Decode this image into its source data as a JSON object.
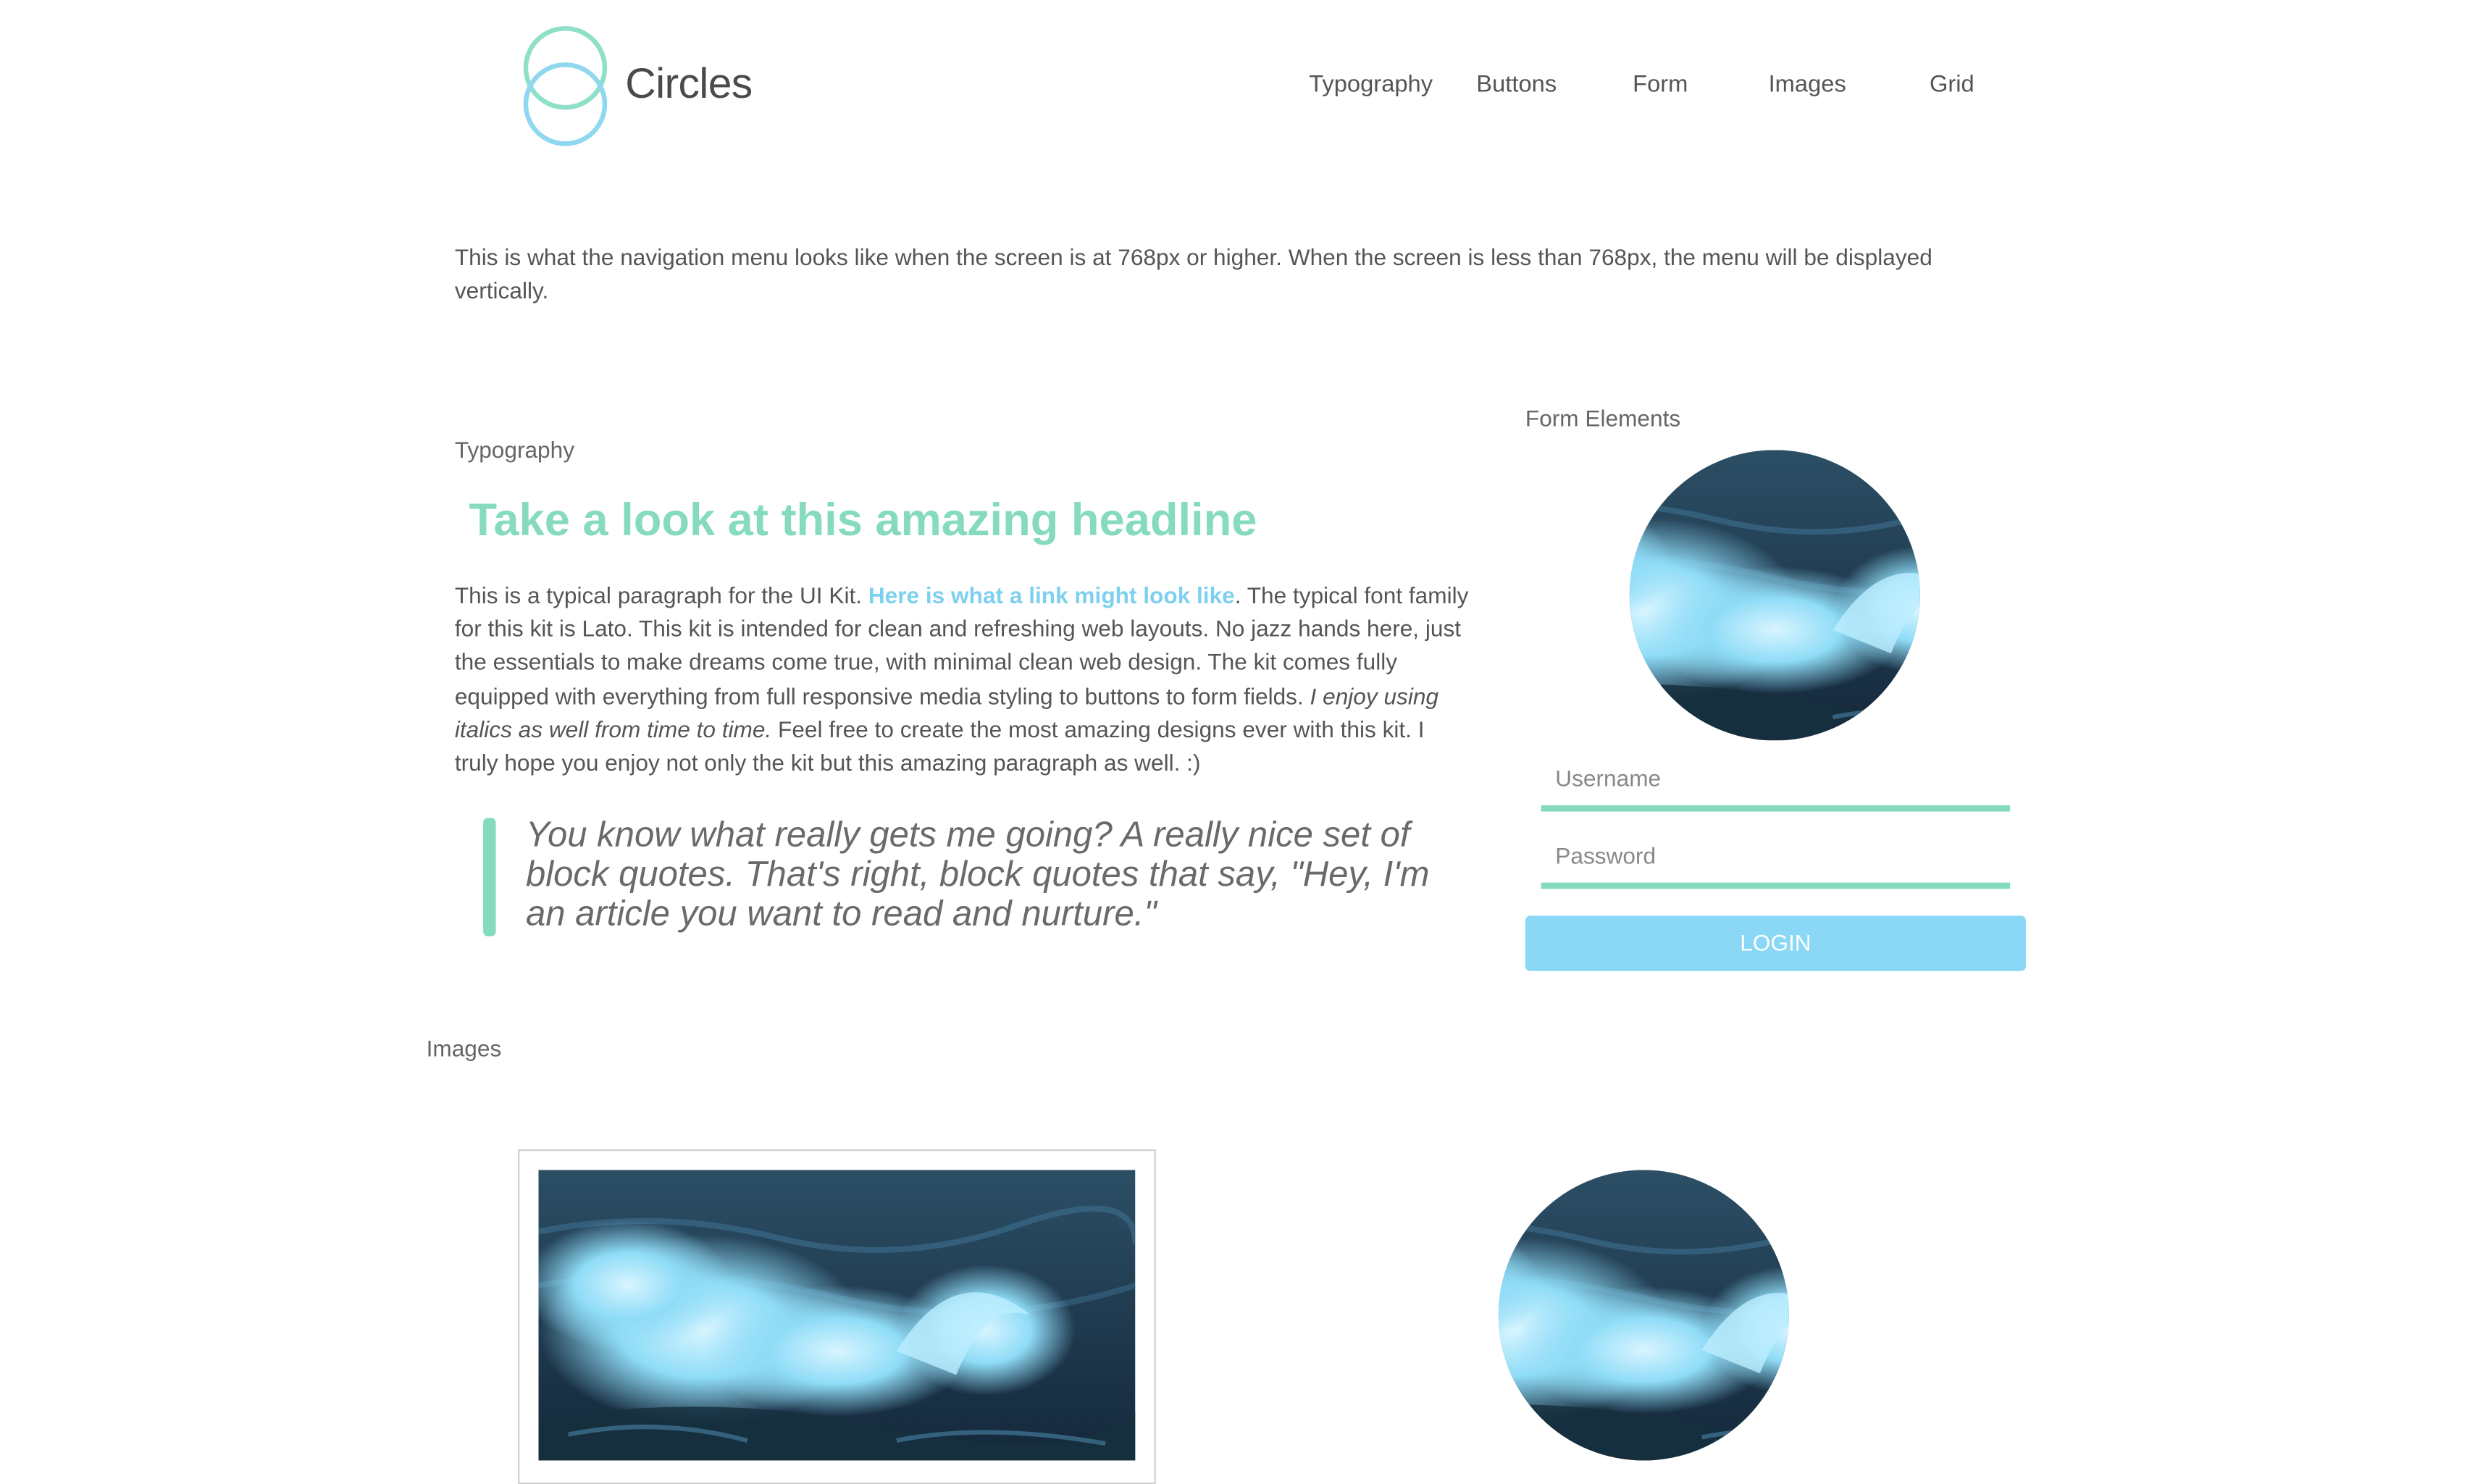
{
  "header": {
    "brand": "Circles",
    "nav": [
      "Typography",
      "Buttons",
      "Form",
      "Images",
      "Grid"
    ]
  },
  "intro": "This is what the navigation menu looks like when the screen is at 768px or higher. When the screen is less than 768px, the menu will be displayed vertically.",
  "typography": {
    "label": "Typography",
    "headline": "Take a look at this amazing headline",
    "para_before_link": "This is a typical paragraph for the UI Kit. ",
    "link": "Here is what a link might look like",
    "para_after_link": ". The typical font family for this kit is Lato. This kit is intended for clean and refreshing web layouts. No jazz hands here, just the essentials to make dreams come true, with minimal clean web design. The kit comes fully equipped with everything from full responsive media styling to buttons to form fields. ",
    "para_italic": "I enjoy using italics as well from time to time.",
    "para_end": " Feel free to create the most amazing designs ever with this kit. I truly hope you enjoy not only the kit but this amazing paragraph as well. :)",
    "blockquote": "You know what really gets me going? A really nice set of block quotes. That's right, block quotes that say, \"Hey, I'm an article you want to read and nurture.\""
  },
  "form": {
    "label": "Form Elements",
    "username_placeholder": "Username",
    "password_placeholder": "Password",
    "login_label": "LOGIN"
  },
  "images": {
    "label": "Images"
  },
  "colors": {
    "accent_green": "#86dbbd",
    "accent_blue": "#8ad8f5",
    "link_blue": "#7ed0f0",
    "text": "#555555"
  }
}
